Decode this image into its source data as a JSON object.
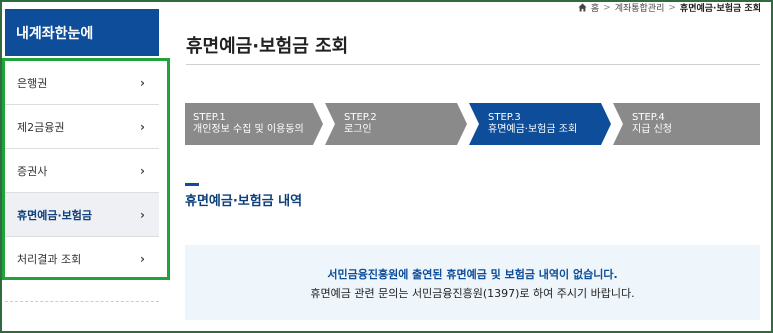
{
  "breadcrumb": {
    "home": "홈",
    "items": [
      "계좌통합관리",
      "휴면예금·보험금 조회"
    ]
  },
  "sidebar": {
    "title": "내계좌한눈에",
    "items": [
      {
        "label": "은행권"
      },
      {
        "label": "제2금융권"
      },
      {
        "label": "증권사"
      },
      {
        "label": "휴면예금·보험금",
        "active": true
      },
      {
        "label": "처리결과 조회"
      }
    ]
  },
  "page": {
    "title": "휴면예금·보험금 조회"
  },
  "steps": [
    {
      "num": "STEP.1",
      "label": "개인정보 수집 및 이용동의",
      "active": false
    },
    {
      "num": "STEP.2",
      "label": "로그인",
      "active": false
    },
    {
      "num": "STEP.3",
      "label": "휴면예금·보험금 조회",
      "active": true
    },
    {
      "num": "STEP.4",
      "label": "지급 신청",
      "active": false
    }
  ],
  "section": {
    "title": "휴면예금·보험금 내역"
  },
  "notice": {
    "line1": "서민금융진흥원에 출연된 휴면예금 및 보험금 내역이 없습니다.",
    "line2": "휴면예금 관련 문의는 서민금융진흥원(1397)로 하여 주시기 바랍니다."
  },
  "colors": {
    "primary": "#0d4d99",
    "step_inactive": "#8a8a8a",
    "highlight_border": "#1fa33a",
    "notice_bg": "#eef5fb"
  }
}
